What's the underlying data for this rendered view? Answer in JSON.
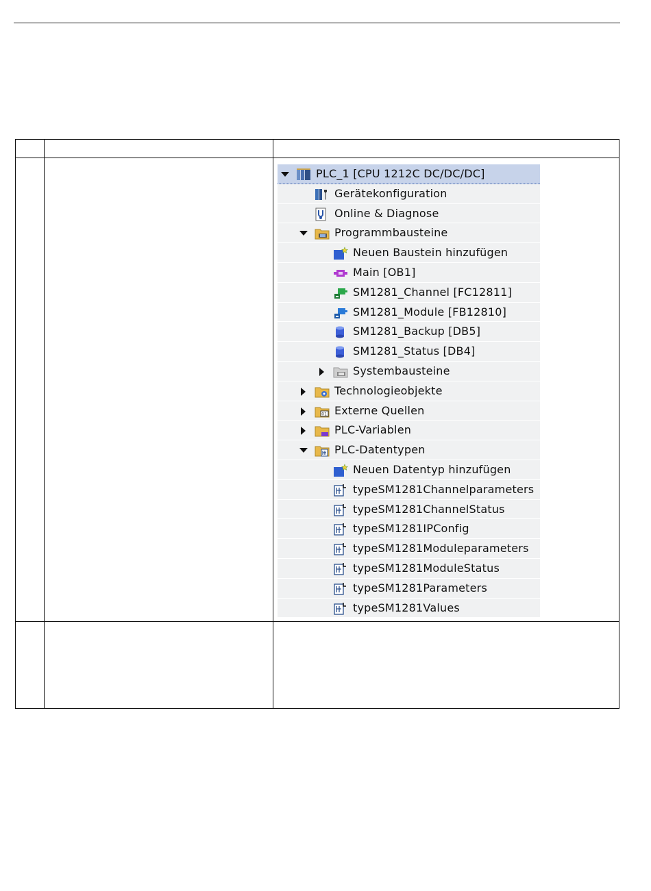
{
  "tree": {
    "items": [
      {
        "label": "PLC_1 [CPU 1212C DC/DC/DC]",
        "level": 0,
        "expander": "open",
        "icon": "plc-icon",
        "selected": true
      },
      {
        "label": "Gerätekonfiguration",
        "level": 1,
        "expander": "none",
        "icon": "device-config-icon"
      },
      {
        "label": "Online & Diagnose",
        "level": 1,
        "expander": "none",
        "icon": "online-diagnostics-icon"
      },
      {
        "label": "Programmbausteine",
        "level": 1,
        "expander": "open",
        "icon": "folder-blocks-icon"
      },
      {
        "label": "Neuen Baustein hinzufügen",
        "level": 2,
        "expander": "none",
        "icon": "add-new-icon"
      },
      {
        "label": "Main [OB1]",
        "level": 2,
        "expander": "none",
        "icon": "ob-block-icon"
      },
      {
        "label": "SM1281_Channel [FC12811]",
        "level": 2,
        "expander": "none",
        "icon": "fc-block-icon"
      },
      {
        "label": "SM1281_Module [FB12810]",
        "level": 2,
        "expander": "none",
        "icon": "fb-block-icon"
      },
      {
        "label": "SM1281_Backup [DB5]",
        "level": 2,
        "expander": "none",
        "icon": "db-block-icon"
      },
      {
        "label": "SM1281_Status [DB4]",
        "level": 2,
        "expander": "none",
        "icon": "db-block-icon"
      },
      {
        "label": "Systembausteine",
        "level": 2,
        "expander": "closed",
        "icon": "system-blocks-icon"
      },
      {
        "label": "Technologieobjekte",
        "level": 1,
        "expander": "closed",
        "icon": "folder-technology-icon"
      },
      {
        "label": "Externe Quellen",
        "level": 1,
        "expander": "closed",
        "icon": "folder-external-icon"
      },
      {
        "label": "PLC-Variablen",
        "level": 1,
        "expander": "closed",
        "icon": "folder-tags-icon"
      },
      {
        "label": "PLC-Datentypen",
        "level": 1,
        "expander": "open",
        "icon": "folder-datatypes-icon"
      },
      {
        "label": "Neuen Datentyp hinzufügen",
        "level": 2,
        "expander": "none",
        "icon": "add-new-icon"
      },
      {
        "label": "typeSM1281Channelparameters",
        "level": 2,
        "expander": "none",
        "icon": "datatype-icon"
      },
      {
        "label": "typeSM1281ChannelStatus",
        "level": 2,
        "expander": "none",
        "icon": "datatype-icon"
      },
      {
        "label": "typeSM1281IPConfig",
        "level": 2,
        "expander": "none",
        "icon": "datatype-icon"
      },
      {
        "label": "typeSM1281Moduleparameters",
        "level": 2,
        "expander": "none",
        "icon": "datatype-icon"
      },
      {
        "label": "typeSM1281ModuleStatus",
        "level": 2,
        "expander": "none",
        "icon": "datatype-icon"
      },
      {
        "label": "typeSM1281Parameters",
        "level": 2,
        "expander": "none",
        "icon": "datatype-icon"
      },
      {
        "label": "typeSM1281Values",
        "level": 2,
        "expander": "none",
        "icon": "datatype-icon"
      }
    ]
  }
}
